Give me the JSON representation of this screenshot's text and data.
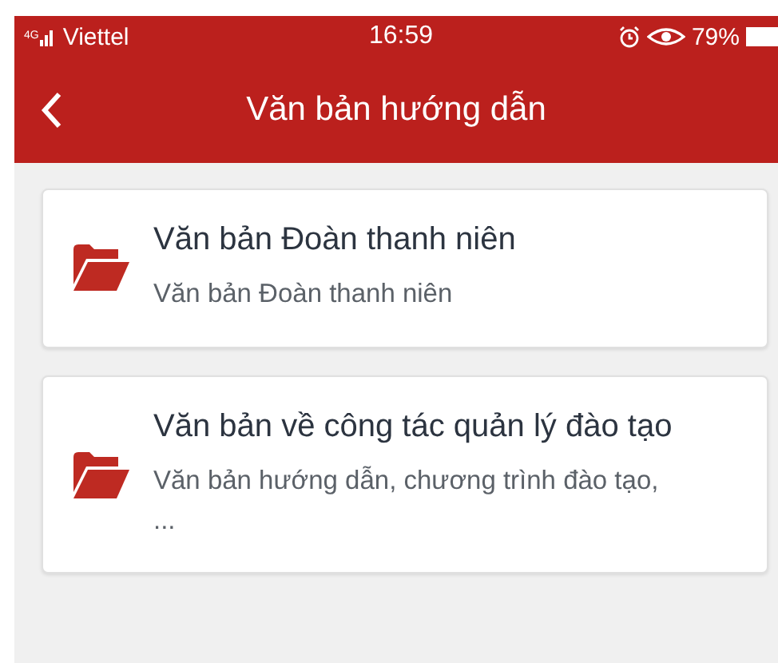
{
  "status_bar": {
    "network_type": "4G",
    "carrier": "Viettel",
    "time": "16:59",
    "battery": "79%"
  },
  "header": {
    "title": "Văn bản hướng dẫn"
  },
  "items": [
    {
      "title": "Văn bản Đoàn thanh niên",
      "subtitle": "Văn bản Đoàn thanh niên"
    },
    {
      "title": "Văn bản về công tác quản lý đào tạo",
      "subtitle": "Văn bản hướng dẫn, chương trình đào tạo, ..."
    }
  ]
}
